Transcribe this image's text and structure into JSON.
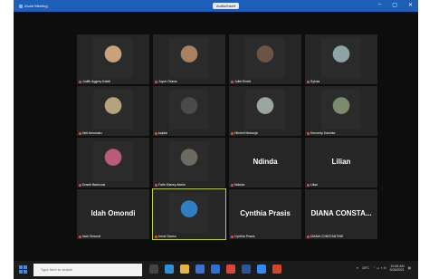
{
  "window": {
    "title": "Zoom Meeting",
    "center_label": "Audio/Insert",
    "controls": [
      "–",
      "▢",
      "✕"
    ]
  },
  "participants": [
    {
      "name": "Judith Aggrey Kateti",
      "type": "video",
      "tone": "#c7a27a"
    },
    {
      "name": "Joyce Oluma",
      "type": "video",
      "tone": "#a88260"
    },
    {
      "name": "Juliet Emeti",
      "type": "video",
      "tone": "#6b5446"
    },
    {
      "name": "Sylvas",
      "type": "video",
      "tone": "#8ea3a8"
    },
    {
      "name": "Neil Amonaku",
      "type": "video",
      "tone": "#b6a27e"
    },
    {
      "name": "kajoke",
      "type": "video",
      "tone": "#4a4a4a"
    },
    {
      "name": "Hitchell Mukanja",
      "type": "video",
      "tone": "#9aa69e"
    },
    {
      "name": "Kennedy Kaninke",
      "type": "video",
      "tone": "#7c8a6e"
    },
    {
      "name": "Doseh Barbrook",
      "type": "video",
      "tone": "#b85c77"
    },
    {
      "name": "Faith Kilarey Akello",
      "type": "video",
      "tone": "#6e6a63"
    },
    {
      "name": "Ndinda",
      "type": "name",
      "display": "Ndinda"
    },
    {
      "name": "Lilian",
      "type": "name",
      "display": "Lilian"
    },
    {
      "name": "Idah Omondi",
      "type": "name",
      "display": "Idah Omondi"
    },
    {
      "name": "Inocir Danso",
      "type": "video",
      "tone": "#2f7fc2",
      "active": true
    },
    {
      "name": "Cynthia Prasis",
      "type": "name",
      "display": "Cynthia Prasis"
    },
    {
      "name": "DIANA CONSTANTINE",
      "type": "name",
      "display": "DIANA CONSTA..."
    }
  ],
  "taskbar": {
    "search_placeholder": "Type here to search",
    "weather": "15°C",
    "time": "10:48 AM",
    "date": "9/28/2021"
  },
  "colors": {
    "mic_muted": "#e0453a",
    "active_border": "#b7d23e",
    "titlebar": "#1e5fb8",
    "taskbar": "#1b1b1b"
  }
}
